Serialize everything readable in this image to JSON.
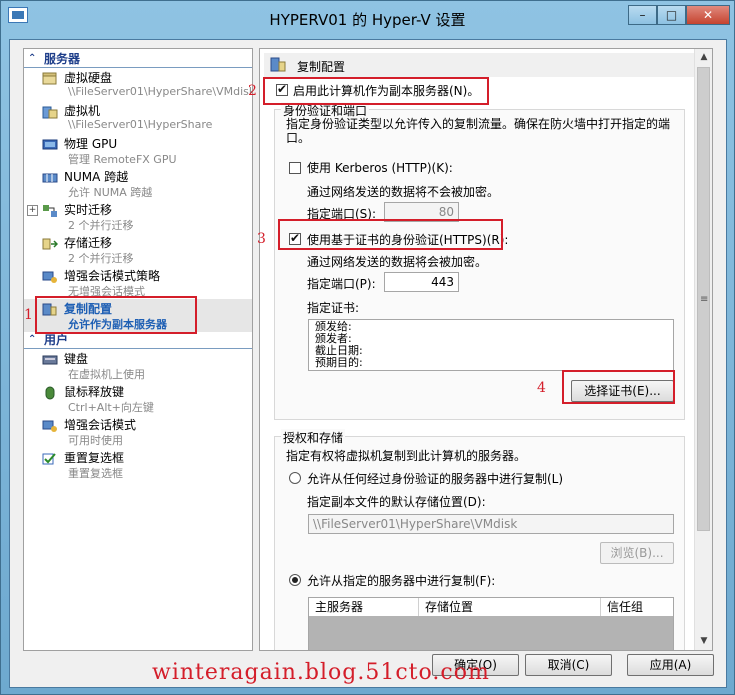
{
  "window": {
    "title": "HYPERV01 的 Hyper-V 设置",
    "minimize": "–",
    "maximize": "□",
    "close": "✕"
  },
  "sidebar": {
    "servers_section": "服务器",
    "users_section": "用户",
    "items": [
      {
        "label": "虚拟硬盘",
        "sub": "\\\\FileServer01\\HyperShare\\VMdisk",
        "icon": "hard-disk-icon"
      },
      {
        "label": "虚拟机",
        "sub": "\\\\FileServer01\\HyperShare",
        "icon": "vm-folder-icon"
      },
      {
        "label": "物理 GPU",
        "sub": "管理 RemoteFX GPU",
        "icon": "gpu-icon"
      },
      {
        "label": "NUMA 跨越",
        "sub": "允许 NUMA 跨越",
        "icon": "numa-icon"
      },
      {
        "label": "实时迁移",
        "sub": "2 个并行迁移",
        "icon": "live-migration-icon"
      },
      {
        "label": "存储迁移",
        "sub": "2 个并行迁移",
        "icon": "storage-migration-icon"
      },
      {
        "label": "增强会话模式策略",
        "sub": "无增强会话模式",
        "icon": "enhanced-session-icon"
      },
      {
        "label": "复制配置",
        "sub": "允许作为副本服务器",
        "icon": "replication-icon"
      },
      {
        "label": "键盘",
        "sub": "在虚拟机上使用",
        "icon": "keyboard-icon"
      },
      {
        "label": "鼠标释放键",
        "sub": "Ctrl+Alt+向左键",
        "icon": "mouse-icon"
      },
      {
        "label": "增强会话模式",
        "sub": "可用时使用",
        "icon": "enhanced-session-icon"
      },
      {
        "label": "重置复选框",
        "sub": "重置复选框",
        "icon": "reset-checkbox-icon"
      }
    ]
  },
  "panel": {
    "header": "复制配置",
    "enable_replica": "启用此计算机作为副本服务器(N)。",
    "auth_group": {
      "title": "身份验证和端口",
      "description": "指定身份验证类型以允许传入的复制流量。确保在防火墙中打开指定的端口。",
      "kerberos_label": "使用 Kerberos (HTTP)(K):",
      "kerberos_note": "通过网络发送的数据将不会被加密。",
      "kerberos_port_label": "指定端口(S):",
      "kerberos_port": "80",
      "https_label": "使用基于证书的身份验证(HTTPS)(R):",
      "https_note": "通过网络发送的数据将会被加密。",
      "https_port_label": "指定端口(P):",
      "https_port": "443",
      "cert_label": "指定证书:",
      "cert_fields": [
        "颁发给:",
        "颁发者:",
        "截止日期:",
        "预期目的:"
      ],
      "select_cert_button": "选择证书(E)..."
    },
    "storage_group": {
      "title": "授权和存储",
      "description": "指定有权将虚拟机复制到此计算机的服务器。",
      "any_server_label": "允许从任何经过身份验证的服务器中进行复制(L)",
      "default_location_label": "指定副本文件的默认存储位置(D):",
      "default_location": "\\\\FileServer01\\HyperShare\\VMdisk",
      "browse_button": "浏览(B)...",
      "specified_servers_label": "允许从指定的服务器中进行复制(F):",
      "table_headers": [
        "主服务器",
        "存储位置",
        "信任组"
      ]
    }
  },
  "footer": {
    "ok": "确定(O)",
    "cancel": "取消(C)",
    "apply": "应用(A)"
  },
  "annotations": [
    "1",
    "2",
    "3",
    "4"
  ],
  "watermark": "winteragain.blog.51cto.com"
}
